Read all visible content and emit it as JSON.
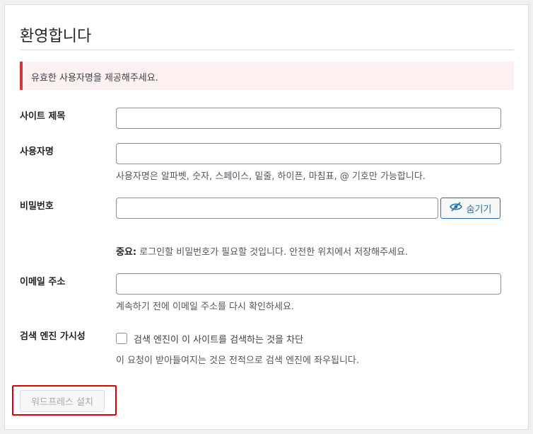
{
  "page": {
    "title": "환영합니다",
    "notice": "유효한 사용자명을 제공해주세요."
  },
  "form": {
    "site_title": {
      "label": "사이트 제목",
      "value": ""
    },
    "username": {
      "label": "사용자명",
      "value": "",
      "description": "사용자명은 알파벳, 숫자, 스페이스, 밑줄, 하이픈, 마침표, @ 기호만 가능합니다."
    },
    "password": {
      "label": "비밀번호",
      "value": "",
      "hide_label": "숨기기",
      "important_prefix": "중요:",
      "important_text": " 로그인할 비밀번호가 필요할 것입니다. 안전한 위치에서 저장해주세요."
    },
    "email": {
      "label": "이메일 주소",
      "value": "",
      "description": "계속하기 전에 이메일 주소를 다시 확인하세요."
    },
    "search_visibility": {
      "label": "검색 엔진 가시성",
      "checkbox_label": "검색 엔진이 이 사이트를 검색하는 것을 차단",
      "checked": false,
      "description": "이 요청이 받아들여지는 것은 전적으로 검색 엔진에 좌우됩니다."
    }
  },
  "actions": {
    "install_label": "워드프레스 설치"
  },
  "colors": {
    "accent": "#2271b1",
    "error": "#d63638",
    "highlight": "#e00000"
  }
}
